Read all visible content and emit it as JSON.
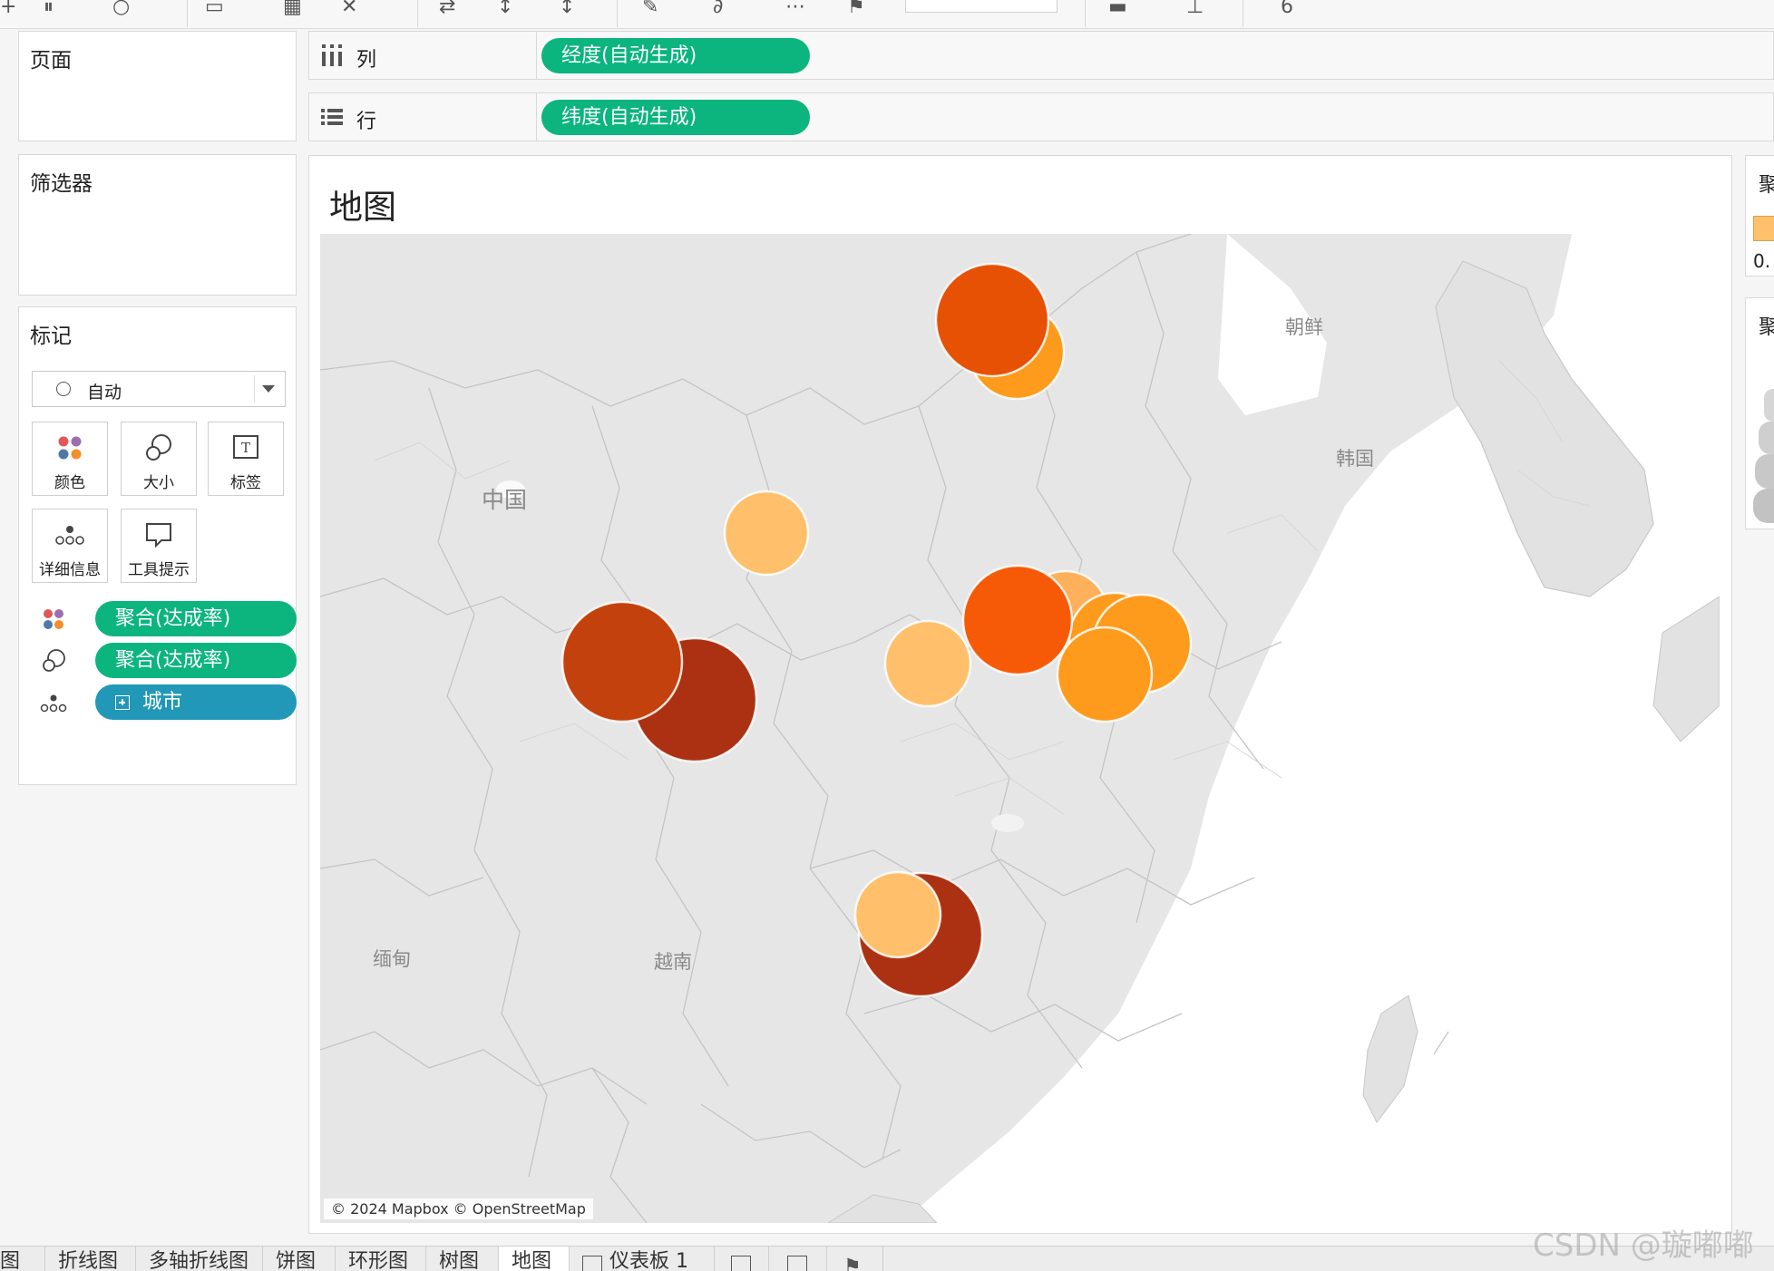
{
  "shelves": {
    "pages_title": "页面",
    "filters_title": "筛选器",
    "columns_label": "列",
    "columns_pill": "经度(自动生成)",
    "rows_label": "行",
    "rows_pill": "纬度(自动生成)"
  },
  "marks": {
    "title": "标记",
    "mark_type": "自动",
    "buttons": [
      {
        "label": "颜色",
        "icon": "color-icon"
      },
      {
        "label": "大小",
        "icon": "size-icon"
      },
      {
        "label": "标签",
        "icon": "label-icon"
      },
      {
        "label": "详细信息",
        "icon": "detail-icon"
      },
      {
        "label": "工具提示",
        "icon": "tooltip-icon"
      }
    ],
    "pills": [
      {
        "label": "聚合(达成率)",
        "icon": "color-icon",
        "color": "#0cb57e"
      },
      {
        "label": "聚合(达成率)",
        "icon": "size-icon",
        "color": "#0cb57e"
      },
      {
        "label": "城市",
        "icon": "detail-icon",
        "color": "#2198b7"
      }
    ]
  },
  "view": {
    "title": "地图",
    "attribution": "© 2024 Mapbox © OpenStreetMap",
    "map_labels": [
      "中国",
      "朝鲜",
      "韩国",
      "缅甸",
      "越南"
    ]
  },
  "legend": {
    "title_fragment": "聚",
    "value_fragment": "0.",
    "size_title_fragment": "聚"
  },
  "tabs": [
    "图",
    "折线图",
    "多轴折线图",
    "饼图",
    "环形图",
    "树图",
    "地图",
    "仪表板 1"
  ],
  "watermark": "CSDN @璇嘟嘟",
  "colors": {
    "pill_green": "#0cb57e",
    "pill_blue": "#2198b7",
    "bubble_palette": [
      "#ffbf6b",
      "#fe9a1c",
      "#f65a06",
      "#e65104",
      "#c3410c",
      "#ac3112"
    ]
  }
}
